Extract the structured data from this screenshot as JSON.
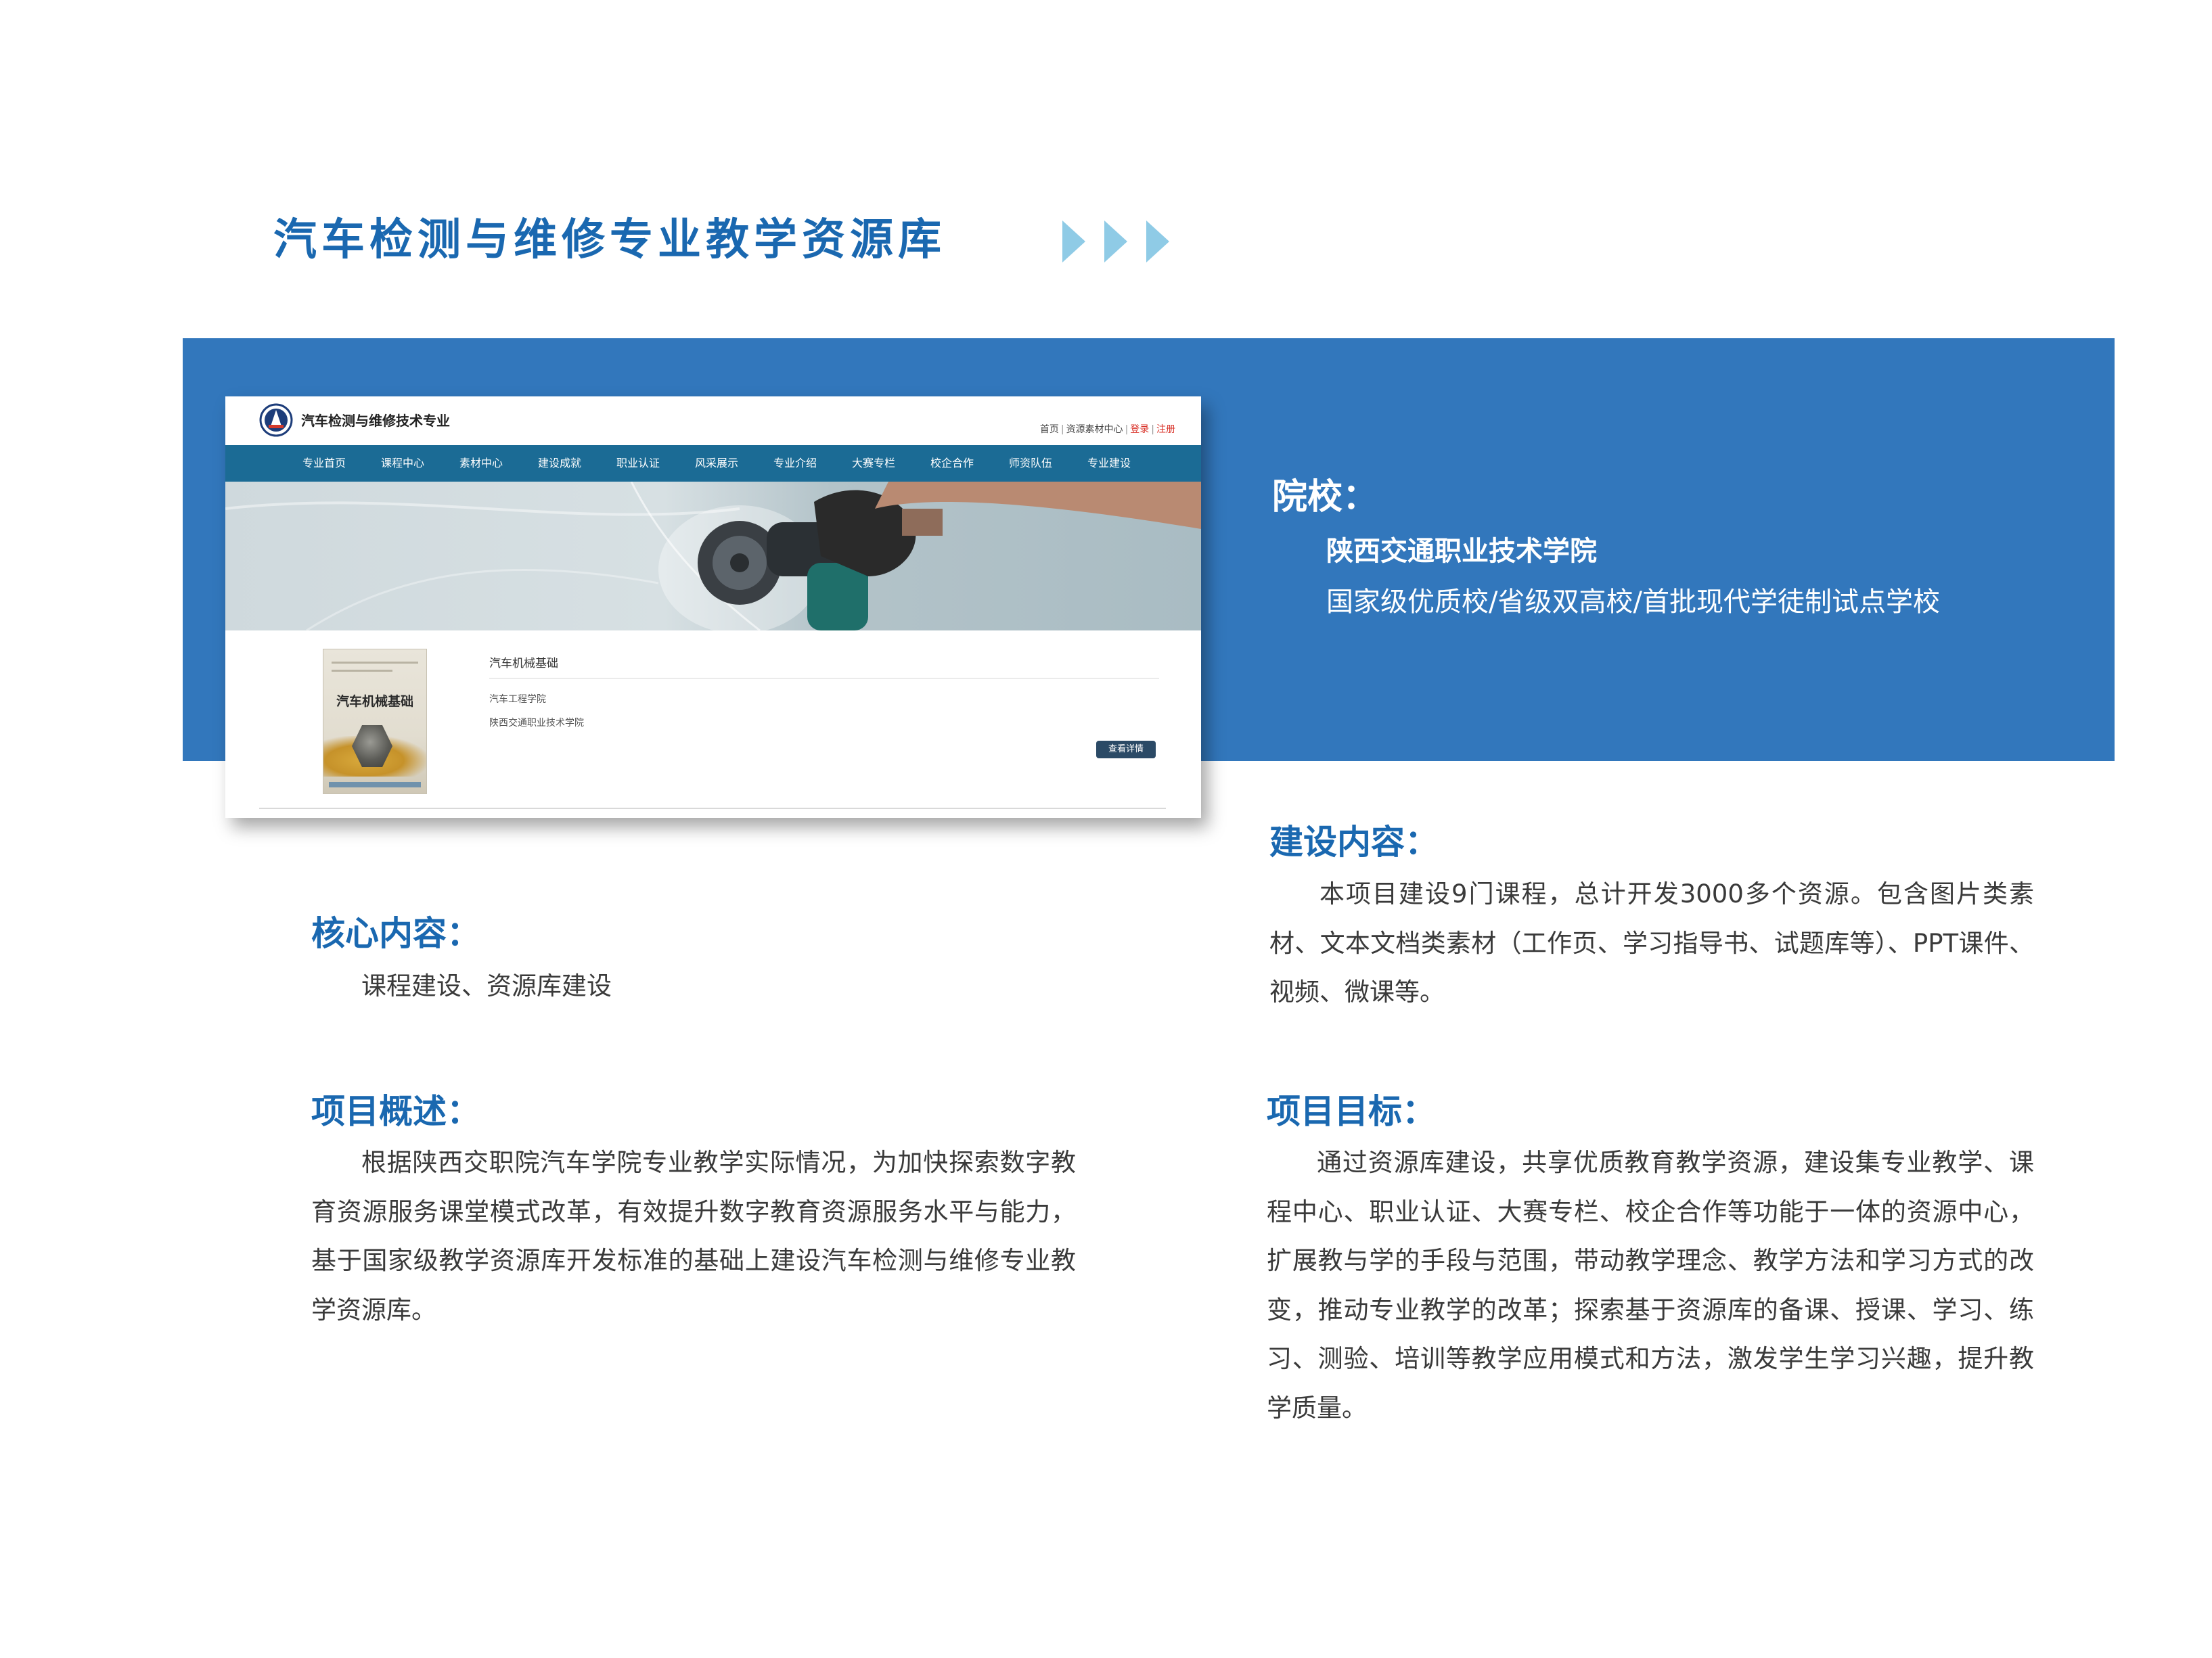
{
  "page": {
    "title": "汽车检测与维修专业教学资源库"
  },
  "screenshot": {
    "site_title": "汽车检测与维修技术专业",
    "top_links": {
      "home": "首页",
      "material_center": "资源素材中心",
      "login": "登录",
      "register": "注册"
    },
    "nav": [
      "专业首页",
      "课程中心",
      "素材中心",
      "建设成就",
      "职业认证",
      "风采展示",
      "专业介绍",
      "大赛专栏",
      "校企合作",
      "师资队伍",
      "专业建设"
    ],
    "course": {
      "cover_title": "汽车机械基础",
      "title": "汽车机械基础",
      "department": "汽车工程学院",
      "school": "陕西交通职业技术学院",
      "detail_button": "查看详情"
    }
  },
  "school": {
    "label": "院校：",
    "name": "陕西交通职业技术学院",
    "description": "国家级优质校/省级双高校/首批现代学徒制试点学校"
  },
  "sections": {
    "core": {
      "title": "核心内容：",
      "body": "课程建设、资源库建设"
    },
    "overview": {
      "title": "项目概述：",
      "body": "根据陕西交职院汽车学院专业教学实际情况，为加快探索数字教育资源服务课堂模式改革，有效提升数字教育资源服务水平与能力，基于国家级教学资源库开发标准的基础上建设汽车检测与维修专业教学资源库。"
    },
    "content": {
      "title": "建设内容：",
      "body": "本项目建设9门课程，总计开发3000多个资源。包含图片类素材、文本文档类素材（工作页、学习指导书、试题库等）、PPT课件、视频、微课等。"
    },
    "goal": {
      "title": "项目目标：",
      "body": "通过资源库建设，共享优质教育教学资源，建设集专业教学、课程中心、职业认证、大赛专栏、校企合作等功能于一体的资源中心，扩展教与学的手段与范围，带动教学理念、教学方法和学习方式的改变，推动专业教学的改革；探索基于资源库的备课、授课、学习、练习、测验、培训等教学应用模式和方法，激发学生学习兴趣，提升教学质量。"
    }
  },
  "colors": {
    "accent_blue": "#1a68b0",
    "band_blue": "#3277bc",
    "nav_teal": "#1b6b95",
    "arrow_light_blue": "#8fcbe6"
  }
}
